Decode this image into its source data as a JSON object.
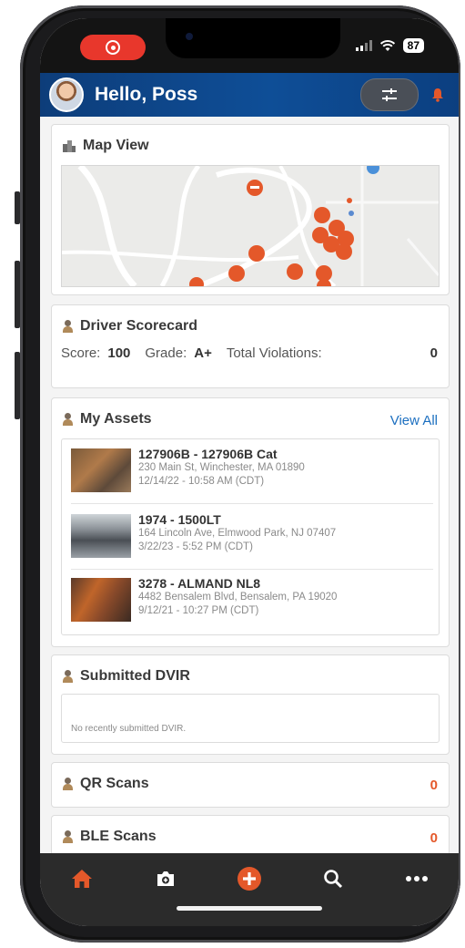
{
  "status": {
    "battery": "87"
  },
  "header": {
    "greeting": "Hello, Poss"
  },
  "map": {
    "title": "Map View"
  },
  "scorecard": {
    "title": "Driver Scorecard",
    "score_label": "Score:",
    "score_value": "100",
    "grade_label": "Grade:",
    "grade_value": "A+",
    "violations_label": "Total Violations:",
    "violations_value": "0"
  },
  "assets": {
    "title": "My Assets",
    "view_all": "View All",
    "items": [
      {
        "title": "127906B - 127906B Cat",
        "address": "230 Main St, Winchester, MA 01890",
        "time": "12/14/22 - 10:58 AM (CDT)"
      },
      {
        "title": "1974 - 1500LT",
        "address": "164 Lincoln Ave, Elmwood Park, NJ 07407",
        "time": "3/22/23 - 5:52 PM (CDT)"
      },
      {
        "title": "3278 - ALMAND NL8",
        "address": "4482 Bensalem Blvd, Bensalem, PA 19020",
        "time": "9/12/21 - 10:27 PM (CDT)"
      }
    ]
  },
  "dvir": {
    "title": "Submitted DVIR",
    "empty_text": "No recently submitted DVIR."
  },
  "qr": {
    "title": "QR Scans",
    "count": "0"
  },
  "ble": {
    "title": "BLE Scans",
    "count": "0"
  },
  "colors": {
    "accent": "#e4582a",
    "header": "#0e4e97",
    "link": "#1c6fc0",
    "tabbar": "#2b2b2b"
  },
  "tabs": [
    "home-icon",
    "camera-icon",
    "add-icon",
    "search-icon",
    "more-icon"
  ]
}
